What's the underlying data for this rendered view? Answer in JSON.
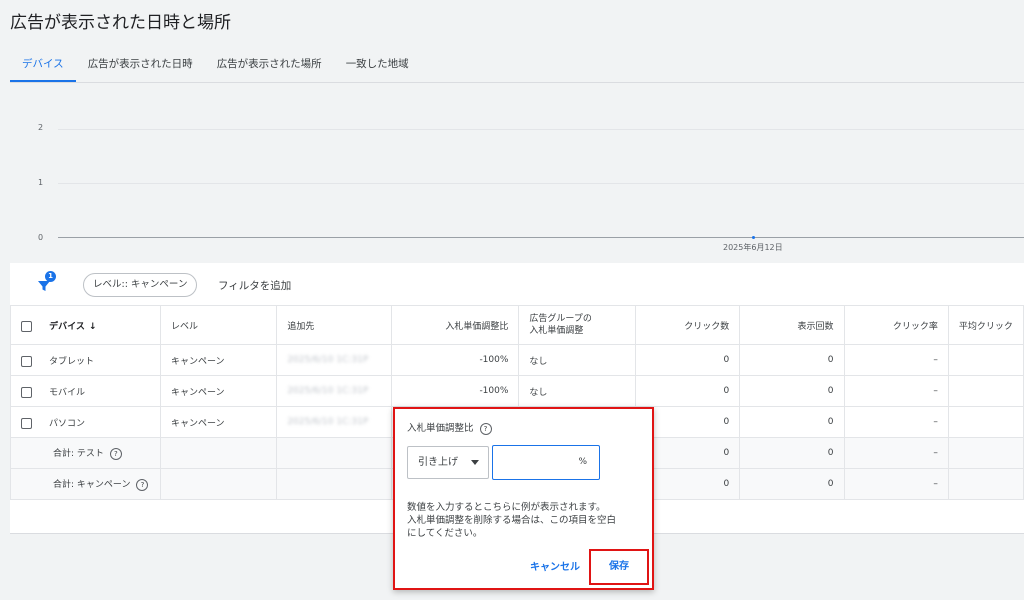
{
  "page": {
    "title": "広告が表示された日時と場所"
  },
  "tabs": [
    {
      "label": "デバイス"
    },
    {
      "label": "広告が表示された日時"
    },
    {
      "label": "広告が表示された場所"
    },
    {
      "label": "一致した地域"
    }
  ],
  "chart": {
    "y_ticks": [
      "2",
      "1",
      "0"
    ],
    "x_label": "2025年6月12日",
    "point_value": 0
  },
  "filters": {
    "badge_count": "1",
    "chip_label": "レベル:: キャンペーン",
    "add_filter_label": "フィルタを追加"
  },
  "table": {
    "headers": {
      "device": "デバイス",
      "sort_arrow": "↓",
      "level": "レベル",
      "target": "追加先",
      "bid_adj": "入札単価調整比",
      "ag_bid_line1": "広告グループの",
      "ag_bid_line2": "入札単価調整",
      "clicks": "クリック数",
      "impressions": "表示回数",
      "ctr": "クリック率",
      "avg_cpc": "平均クリック"
    },
    "rows": [
      {
        "device": "タブレット",
        "level": "キャンペーン",
        "target": "2025/6/10 1C:31P",
        "bid_adj": "-100%",
        "ag_bid": "なし",
        "clicks": "0",
        "impressions": "0",
        "ctr": "–"
      },
      {
        "device": "モバイル",
        "level": "キャンペーン",
        "target": "2025/6/10 1C:31P",
        "bid_adj": "-100%",
        "ag_bid": "なし",
        "clicks": "0",
        "impressions": "0",
        "ctr": "–"
      },
      {
        "device": "パソコン",
        "level": "キャンペーン",
        "target": "2025/6/10 1C:31P",
        "bid_adj": "",
        "ag_bid": "",
        "clicks": "0",
        "impressions": "0",
        "ctr": "–"
      }
    ],
    "totals": [
      {
        "label": "合計: テスト",
        "clicks": "0",
        "impressions": "0",
        "ctr": "–"
      },
      {
        "label": "合計: キャンペーン",
        "clicks": "0",
        "impressions": "0",
        "ctr": "–"
      }
    ]
  },
  "popup": {
    "title": "入札単価調整比",
    "select_value": "引き上げ",
    "input_suffix": "%",
    "hint_line1": "数値を入力するとこちらに例が表示されます。",
    "hint_line2": "入札単価調整を削除する場合は、この項目を空白",
    "hint_line3": "にしてください。",
    "cancel_label": "キャンセル",
    "save_label": "保存"
  },
  "colors": {
    "accent": "#1a73e8",
    "highlight": "#e01414"
  }
}
